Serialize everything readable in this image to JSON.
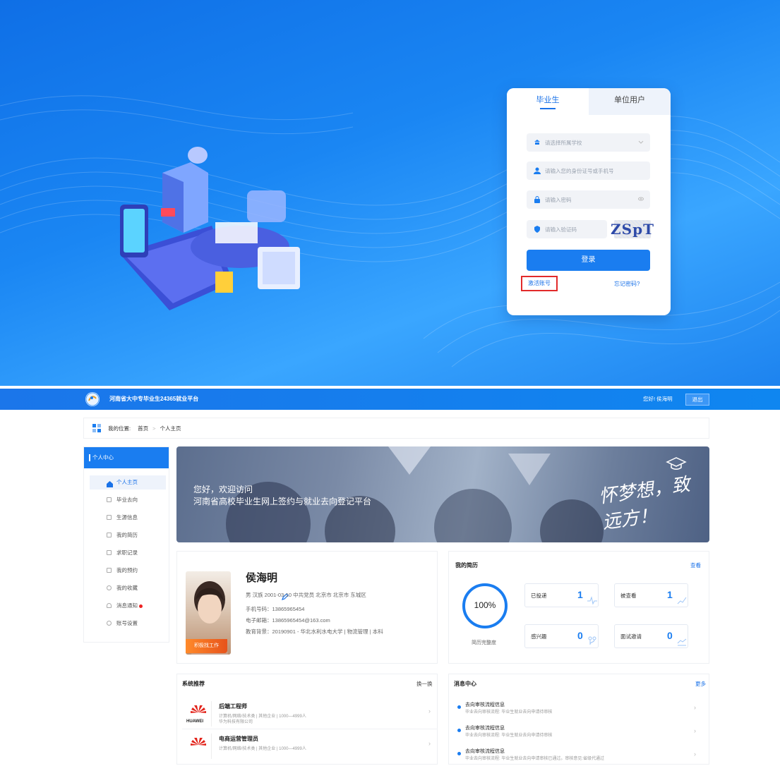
{
  "login": {
    "tabs": [
      "毕业生",
      "单位用户"
    ],
    "school_placeholder": "请选择所属学校",
    "id_placeholder": "请输入您的身份证号或手机号",
    "password_placeholder": "请输入密码",
    "captcha_placeholder": "请输入验证码",
    "captcha_text": "ZSpT",
    "login_button": "登录",
    "activate_link": "激活账号",
    "forgot_link": "忘记密码?"
  },
  "topbar": {
    "site_name": "河南省大中专毕业生24365就业平台",
    "greeting": "您好! 侯海明",
    "logout": "退出"
  },
  "breadcrumb": {
    "label": "我的位置:",
    "home": "首页",
    "current": "个人主页"
  },
  "sidenav": {
    "header": "个人中心",
    "items": [
      "个人主页",
      "毕业去向",
      "生源信息",
      "我的简历",
      "求职记录",
      "我的预约",
      "我的收藏",
      "消息通知",
      "账号设置"
    ]
  },
  "banner": {
    "line1": "您好，欢迎访问",
    "line2": "河南省高校毕业生网上签约与就业去向登记平台",
    "slogan": "怀梦想，致远方！"
  },
  "profile": {
    "name": "侯海明",
    "basic": "男 汉族 2001-03-10 中共党员 北京市 北京市 东城区",
    "phone": "手机号码：13865965454",
    "email": "电子邮箱：13865965454@163.com",
    "education": "教育背景：20190901 - 华北水利水电大学 | 物流管理 | 本科",
    "status_badge": "积极找工作"
  },
  "resume": {
    "title": "我的简历",
    "view": "查看",
    "completeness": "100%",
    "completeness_label": "简历完整度",
    "stats": [
      {
        "label": "已投递",
        "value": "1"
      },
      {
        "label": "被查看",
        "value": "1"
      },
      {
        "label": "感兴趣",
        "value": "0"
      },
      {
        "label": "面试邀请",
        "value": "0"
      }
    ]
  },
  "recommend": {
    "title": "系统推荐",
    "refresh": "换一换",
    "jobs": [
      {
        "title": "后端工程师",
        "tags": "计算机/网络/技术类 | 其他企业 | 1000—4999人",
        "company": "华为科技有限公司",
        "logo_text": "HUAWEI"
      },
      {
        "title": "电商运营管理员",
        "tags": "计算机/网络/技术类 | 其他企业 | 1000—4999人",
        "company": "",
        "logo_text": "HUAWEI"
      }
    ]
  },
  "messages": {
    "title": "消息中心",
    "more": "更多",
    "items": [
      {
        "title": "去向审核流程信息",
        "desc": "毕业去向审核流程: 毕业生就业去向申请待审核"
      },
      {
        "title": "去向审核流程信息",
        "desc": "毕业去向审核流程: 毕业生就业去向申请待审核"
      },
      {
        "title": "去向审核流程信息",
        "desc": "毕业去向审核流程: 毕业生就业去向申请审核已通过。审核意见:省级代通过"
      }
    ]
  },
  "colors": {
    "primary": "#1a7df0",
    "alert": "#e22a2a",
    "badge": "#e7531b"
  }
}
